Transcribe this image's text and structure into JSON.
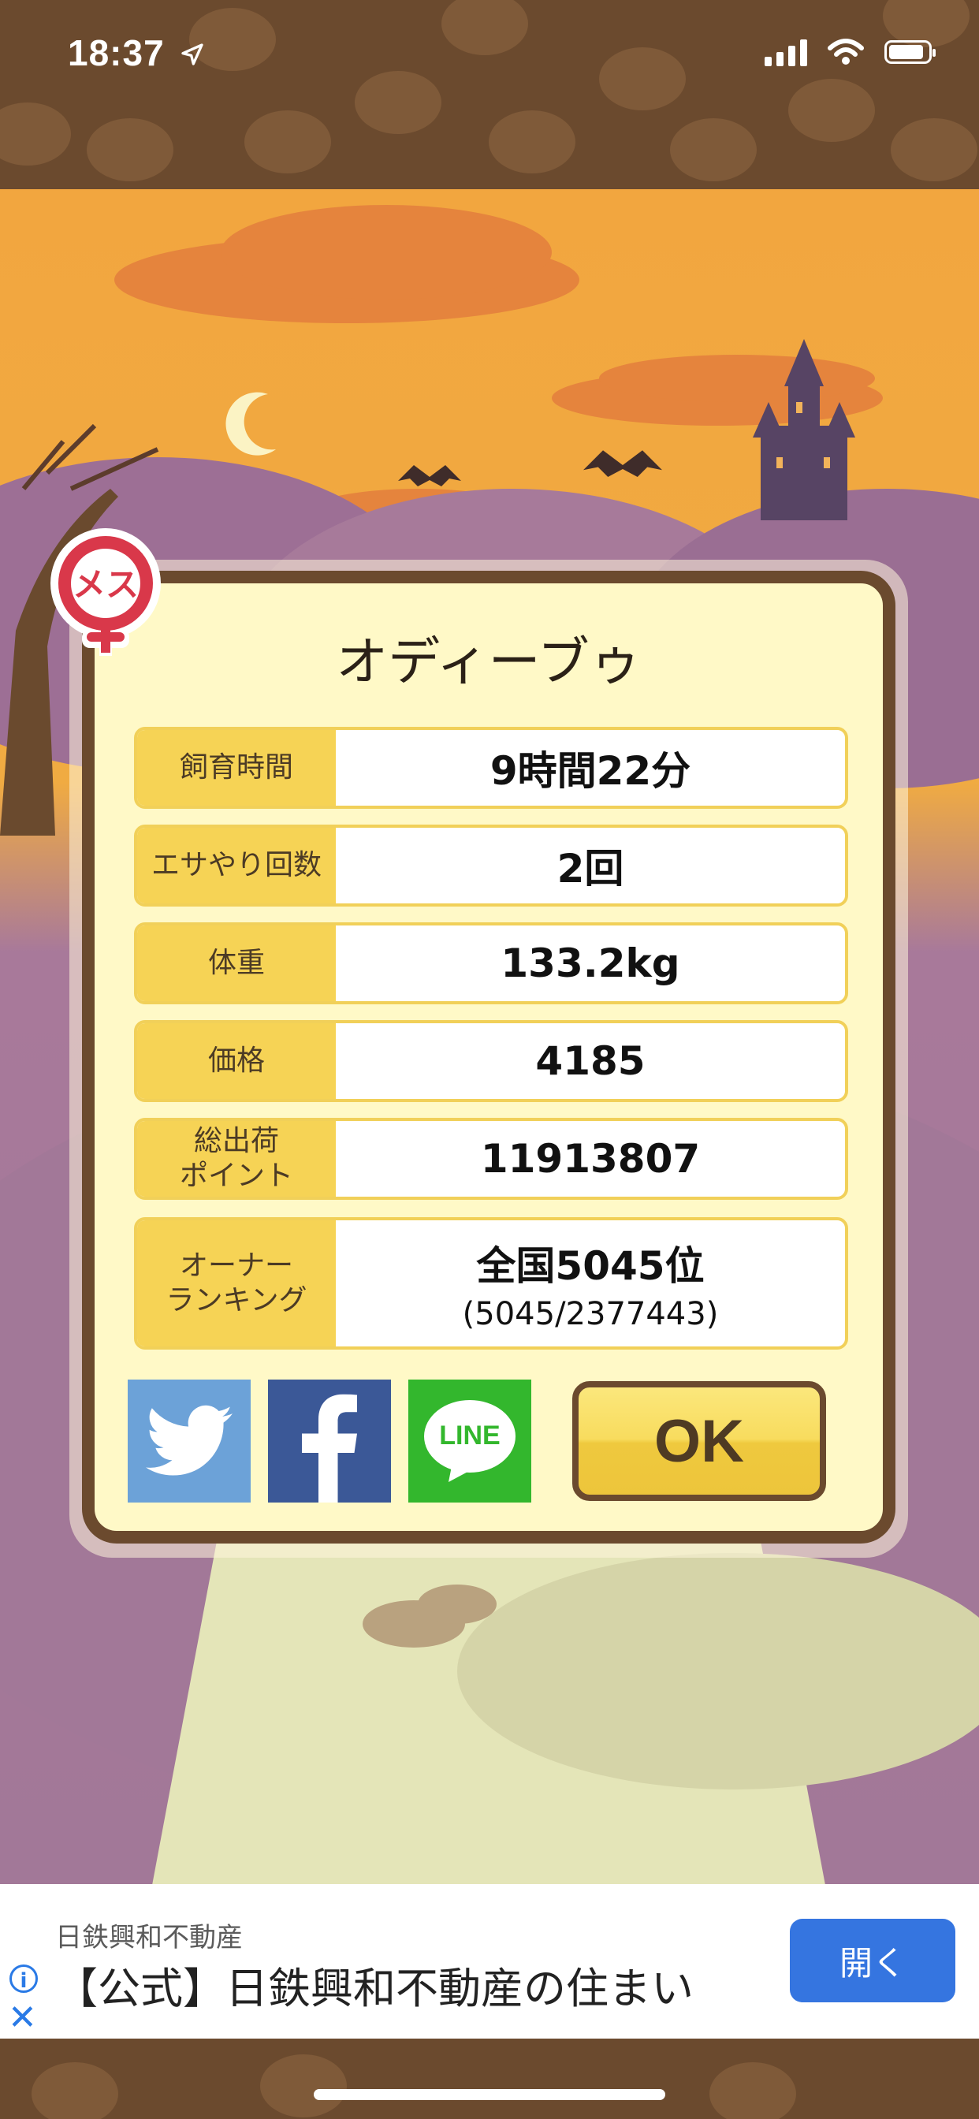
{
  "status": {
    "time": "18:37"
  },
  "pet": {
    "name": "オディーブゥ",
    "gender_label": "メス",
    "stats": [
      {
        "label": "飼育時間",
        "value": "9時間22分"
      },
      {
        "label": "エサやり回数",
        "value": "2回"
      },
      {
        "label": "体重",
        "value": "133.2kg"
      },
      {
        "label": "価格",
        "value": "4185"
      },
      {
        "label": "総出荷\nポイント",
        "value": "11913807"
      }
    ],
    "ranking": {
      "label": "オーナー\nランキング",
      "value": "全国5045位",
      "detail": "(5045/2377443)"
    }
  },
  "share": {
    "line_label": "LINE"
  },
  "buttons": {
    "ok_label": "OK"
  },
  "ad": {
    "sponsor": "日鉄興和不動産",
    "headline": "【公式】日鉄興和不動産の住まい",
    "cta": "開く",
    "info_label": "i",
    "close_label": "✕"
  },
  "colors": {
    "frame": "#6b4a2e",
    "label_bg": "#f6d355",
    "panel_bg": "#fff9c7",
    "twitter": "#6ca2d8",
    "facebook": "#3b5897",
    "line": "#33b72d",
    "badge_red": "#d9384a"
  }
}
